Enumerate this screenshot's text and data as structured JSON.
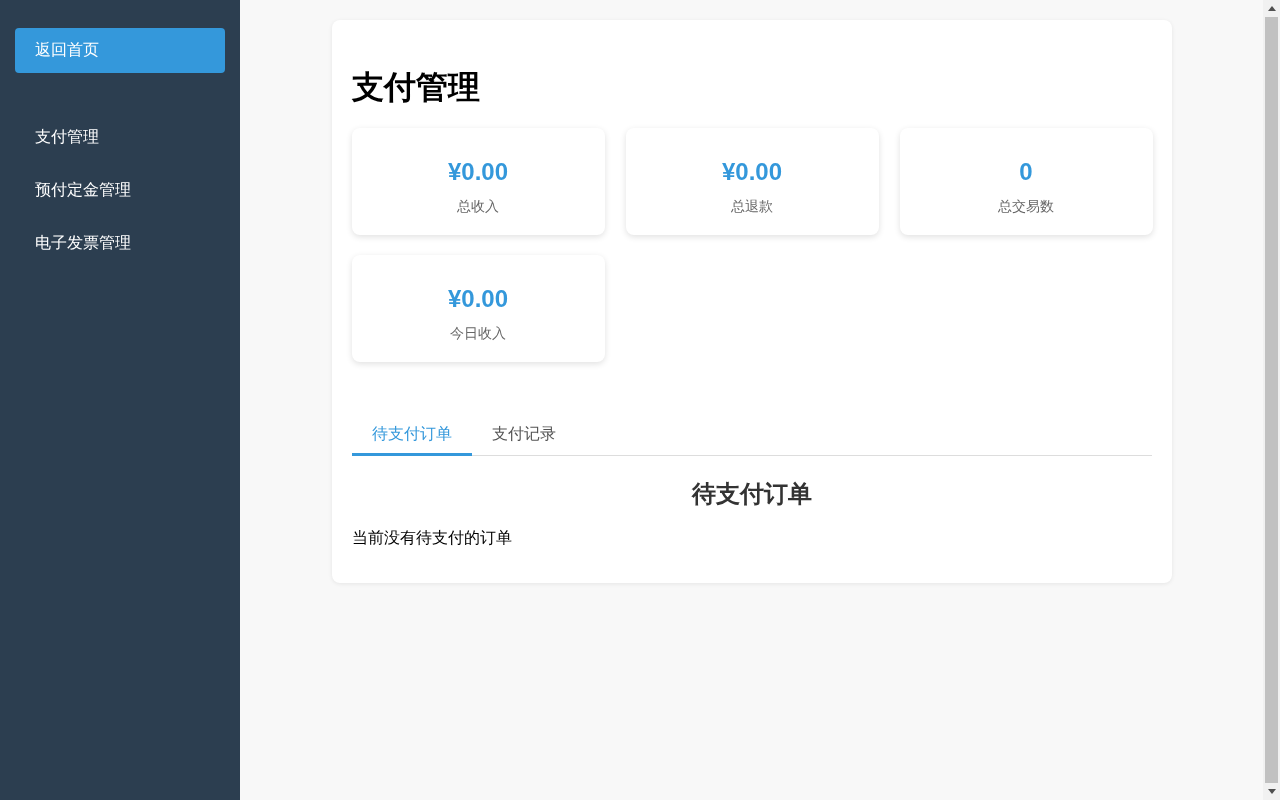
{
  "sidebar": {
    "home_button": "返回首页",
    "items": [
      {
        "label": "支付管理"
      },
      {
        "label": "预付定金管理"
      },
      {
        "label": "电子发票管理"
      }
    ]
  },
  "page": {
    "title": "支付管理",
    "stats": [
      {
        "value": "¥0.00",
        "label": "总收入"
      },
      {
        "value": "¥0.00",
        "label": "总退款"
      },
      {
        "value": "0",
        "label": "总交易数"
      },
      {
        "value": "¥0.00",
        "label": "今日收入"
      }
    ],
    "tabs": [
      {
        "label": "待支付订单",
        "selected": true
      },
      {
        "label": "支付记录",
        "selected": false
      }
    ],
    "section": {
      "heading": "待支付订单",
      "message": "当前没有待支付的订单"
    }
  }
}
